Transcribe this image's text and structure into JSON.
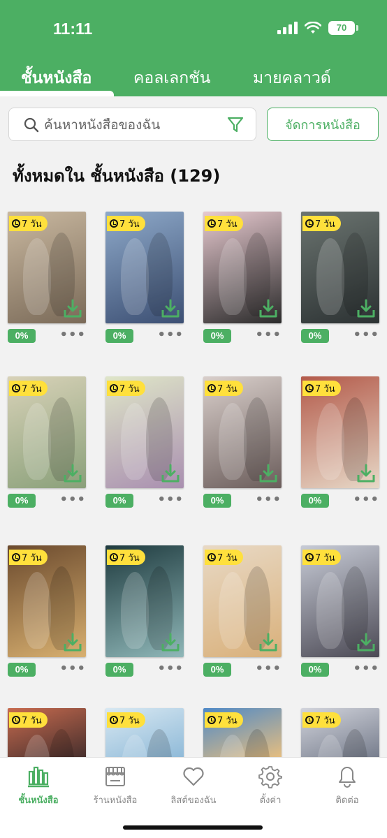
{
  "status_bar": {
    "time": "11:11",
    "battery": "70"
  },
  "tabs": [
    {
      "label": "ชั้นหนังสือ",
      "active": true
    },
    {
      "label": "คอลเลกชัน",
      "active": false
    },
    {
      "label": "มายคลาวด์",
      "active": false
    }
  ],
  "search": {
    "placeholder": "ค้นหาหนังสือของฉัน"
  },
  "manage_button": "จัดการหนังสือ",
  "section_title": "ทั้งหมดใน ชั้นหนังสือ (129)",
  "books": [
    {
      "badge": "7 วัน",
      "progress": "0%"
    },
    {
      "badge": "7 วัน",
      "progress": "0%"
    },
    {
      "badge": "7 วัน",
      "progress": "0%"
    },
    {
      "badge": "7 วัน",
      "progress": "0%"
    },
    {
      "badge": "7 วัน",
      "progress": "0%"
    },
    {
      "badge": "7 วัน",
      "progress": "0%"
    },
    {
      "badge": "7 วัน",
      "progress": "0%"
    },
    {
      "badge": "7 วัน",
      "progress": "0%"
    },
    {
      "badge": "7 วัน",
      "progress": "0%"
    },
    {
      "badge": "7 วัน",
      "progress": "0%"
    },
    {
      "badge": "7 วัน",
      "progress": "0%"
    },
    {
      "badge": "7 วัน",
      "progress": "0%"
    },
    {
      "badge": "7 วัน",
      "progress": ""
    },
    {
      "badge": "7 วัน",
      "progress": ""
    },
    {
      "badge": "7 วัน",
      "progress": ""
    },
    {
      "badge": "7 วัน",
      "progress": ""
    }
  ],
  "more_label": "•••",
  "bottom_nav": [
    {
      "label": "ชั้นหนังสือ",
      "icon": "bookshelf-icon",
      "active": true
    },
    {
      "label": "ร้านหนังสือ",
      "icon": "store-icon",
      "active": false
    },
    {
      "label": "ลิสต์ของฉัน",
      "icon": "heart-icon",
      "active": false
    },
    {
      "label": "ตั้งค่า",
      "icon": "gear-icon",
      "active": false
    },
    {
      "label": "ติดต่อ",
      "icon": "bell-icon",
      "active": false
    }
  ],
  "colors": {
    "accent": "#4caf63",
    "badge": "#ffe03c",
    "background": "#f2f2f2"
  }
}
